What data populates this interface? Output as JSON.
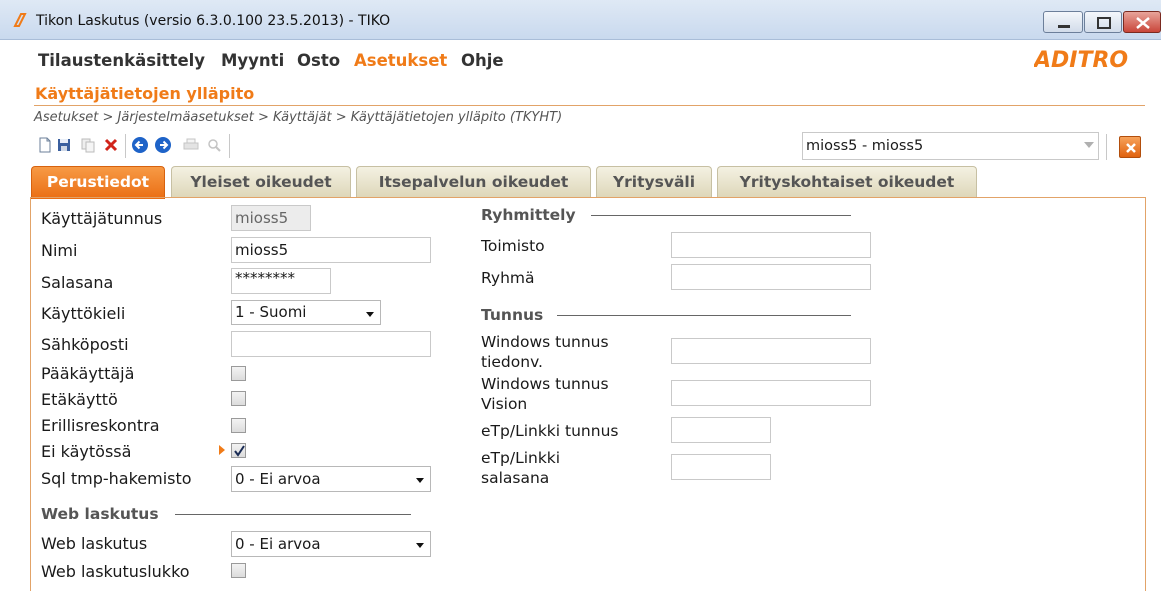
{
  "window": {
    "title": "Tikon Laskutus (versio 6.3.0.100 23.5.2013) - TIKO"
  },
  "menu": {
    "items": [
      "Tilaustenkäsittely",
      "Myynti",
      "Osto",
      "Asetukset",
      "Ohje"
    ],
    "active": "Asetukset"
  },
  "brand": {
    "logo_text": "ADITRO",
    "accent_color": "#f07b18"
  },
  "page": {
    "title": "Käyttäjätietojen ylläpito",
    "breadcrumb": "Asetukset > Järjestelmäasetukset > Käyttäjät > Käyttäjätietojen ylläpito  (TKYHT)"
  },
  "toolbar": {
    "icons": [
      "new-document-icon",
      "save-icon",
      "copy-icon",
      "delete-icon",
      "back-icon",
      "forward-icon",
      "print-icon",
      "search-icon"
    ]
  },
  "user_selector": {
    "value": "mioss5 - mioss5"
  },
  "tabs": [
    "Perustiedot",
    "Yleiset oikeudet",
    "Itsepalvelun oikeudet",
    "Yritysväli",
    "Yrityskohtaiset oikeudet"
  ],
  "active_tab": "Perustiedot",
  "form": {
    "kayttajatunnus": {
      "label": "Käyttäjätunnus",
      "value": "mioss5"
    },
    "nimi": {
      "label": "Nimi",
      "value": "mioss5"
    },
    "salasana": {
      "label": "Salasana",
      "value": "********"
    },
    "kayttokieli": {
      "label": "Käyttökieli",
      "value": "1 - Suomi"
    },
    "sahkoposti": {
      "label": "Sähköposti",
      "value": ""
    },
    "paakayttaja": {
      "label": "Pääkäyttäjä",
      "checked": false
    },
    "etakaytto": {
      "label": "Etäkäyttö",
      "checked": false
    },
    "erillisreskontra": {
      "label": "Erillisreskontra",
      "checked": false
    },
    "ei_kaytossa": {
      "label": "Ei käytössä",
      "checked": true
    },
    "sql_tmp": {
      "label": "Sql tmp-hakemisto",
      "value": "0  -  Ei arvoa"
    }
  },
  "web_laskutus": {
    "section_title": "Web laskutus",
    "web_laskutus": {
      "label": "Web laskutus",
      "value": "0  -  Ei arvoa"
    },
    "web_laskutuslukko": {
      "label": "Web laskutuslukko",
      "checked": false
    }
  },
  "ryhmittely": {
    "section_title": "Ryhmittely",
    "toimisto": {
      "label": "Toimisto",
      "value": ""
    },
    "ryhma": {
      "label": "Ryhmä",
      "value": ""
    }
  },
  "tunnus": {
    "section_title": "Tunnus",
    "win_tiedonv": {
      "label_line1": "Windows tunnus",
      "label_line2": "tiedonv.",
      "value": ""
    },
    "win_vision": {
      "label_line1": "Windows tunnus",
      "label_line2": "Vision",
      "value": ""
    },
    "etp_tunnus": {
      "label": "eTp/Linkki tunnus",
      "value": ""
    },
    "etp_salasana": {
      "label_line1": "eTp/Linkki",
      "label_line2": "salasana",
      "value": ""
    }
  }
}
